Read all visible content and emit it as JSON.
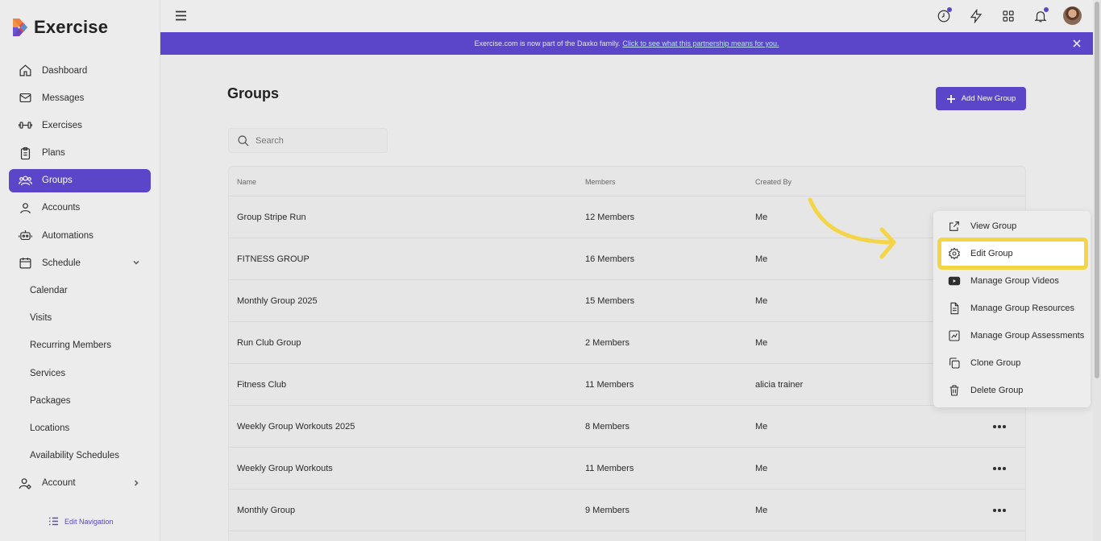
{
  "app": {
    "name": "Exercise"
  },
  "sidebar": {
    "items": [
      {
        "label": "Dashboard",
        "icon": "home-icon"
      },
      {
        "label": "Messages",
        "icon": "mail-icon"
      },
      {
        "label": "Exercises",
        "icon": "dumbbell-icon"
      },
      {
        "label": "Plans",
        "icon": "clipboard-icon"
      },
      {
        "label": "Groups",
        "icon": "users-icon",
        "active": true
      },
      {
        "label": "Accounts",
        "icon": "user-icon"
      },
      {
        "label": "Automations",
        "icon": "robot-icon"
      },
      {
        "label": "Schedule",
        "icon": "calendar-icon",
        "expandable": true
      },
      {
        "label": "Calendar"
      },
      {
        "label": "Visits"
      },
      {
        "label": "Recurring Members"
      },
      {
        "label": "Services"
      },
      {
        "label": "Packages"
      },
      {
        "label": "Locations"
      },
      {
        "label": "Availability Schedules"
      },
      {
        "label": "Account",
        "icon": "user-gear-icon",
        "expandable": true
      }
    ],
    "edit_navigation": "Edit Navigation"
  },
  "banner": {
    "text": "Exercise.com is now part of the Daxko family.",
    "link": "Click to see what this partnership means for you."
  },
  "page": {
    "title": "Groups",
    "add_button": "Add New Group",
    "search_placeholder": "Search"
  },
  "table": {
    "columns": [
      "Name",
      "Members",
      "Created By"
    ],
    "rows": [
      {
        "name": "Group Stripe Run",
        "members": "12 Members",
        "created_by": "Me"
      },
      {
        "name": "FITNESS GROUP",
        "members": "16 Members",
        "created_by": "Me"
      },
      {
        "name": "Monthly Group 2025",
        "members": "15 Members",
        "created_by": "Me"
      },
      {
        "name": "Run Club Group",
        "members": "2 Members",
        "created_by": "Me"
      },
      {
        "name": "Fitness Club",
        "members": "11 Members",
        "created_by": "alicia trainer"
      },
      {
        "name": "Weekly Group Workouts 2025",
        "members": "8 Members",
        "created_by": "Me"
      },
      {
        "name": "Weekly Group Workouts",
        "members": "11 Members",
        "created_by": "Me"
      },
      {
        "name": "Monthly Group",
        "members": "9 Members",
        "created_by": "Me"
      }
    ]
  },
  "menu": {
    "items": [
      {
        "label": "View Group",
        "icon": "external-link-icon"
      },
      {
        "label": "Edit Group",
        "icon": "gear-icon",
        "highlighted": true
      },
      {
        "label": "Manage Group Videos",
        "icon": "video-icon"
      },
      {
        "label": "Manage Group Resources",
        "icon": "document-icon"
      },
      {
        "label": "Manage Group Assessments",
        "icon": "assessment-icon"
      },
      {
        "label": "Clone Group",
        "icon": "copy-icon"
      },
      {
        "label": "Delete Group",
        "icon": "trash-icon"
      }
    ]
  },
  "colors": {
    "accent": "#5b46c9",
    "highlight": "#f4d548"
  }
}
